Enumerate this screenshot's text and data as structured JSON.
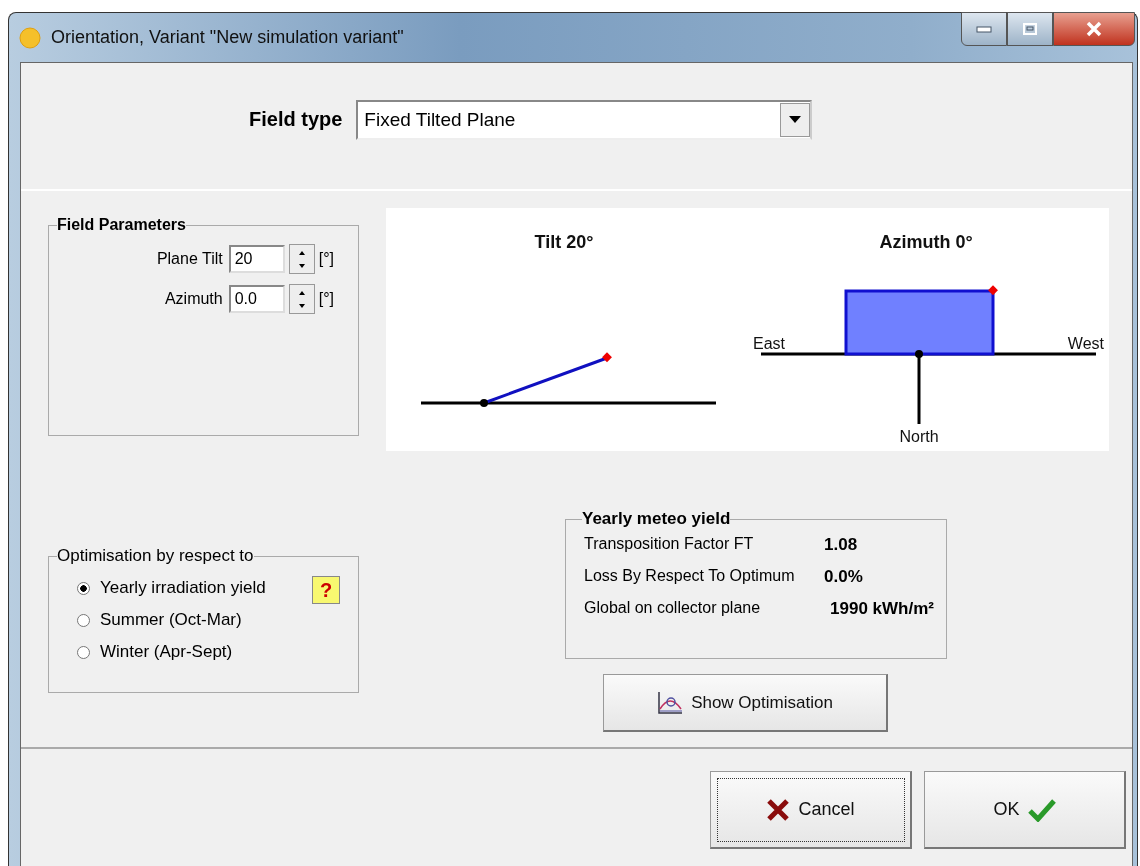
{
  "window": {
    "title": "Orientation, Variant \"New simulation variant\""
  },
  "field_type": {
    "label": "Field type",
    "value": "Fixed Tilted Plane"
  },
  "field_parameters": {
    "title": "Field Parameters",
    "fields": [
      {
        "label": "Plane Tilt",
        "value": "20",
        "unit": "[°]"
      },
      {
        "label": "Azimuth",
        "value": "0.0",
        "unit": "[°]"
      }
    ]
  },
  "diagrams": {
    "tilt_title": "Tilt 20°",
    "azimuth_title": "Azimuth 0°",
    "east": "East",
    "west": "West",
    "north": "North"
  },
  "optimisation": {
    "title": "Optimisation by respect to",
    "help": "?",
    "options": [
      {
        "label": "Yearly irradiation yield",
        "selected": true
      },
      {
        "label": "Summer (Oct-Mar)",
        "selected": false
      },
      {
        "label": "Winter (Apr-Sept)",
        "selected": false
      }
    ]
  },
  "yearly_meteo_yield": {
    "title": "Yearly meteo yield",
    "rows": [
      {
        "label": "Transposition Factor FT",
        "value": "1.08"
      },
      {
        "label": "Loss By Respect To Optimum",
        "value": "0.0%"
      },
      {
        "label": "Global on collector plane",
        "value": "1990 kWh/m²"
      }
    ]
  },
  "buttons": {
    "show_optimisation": "Show Optimisation",
    "cancel": "Cancel",
    "ok": "OK"
  }
}
